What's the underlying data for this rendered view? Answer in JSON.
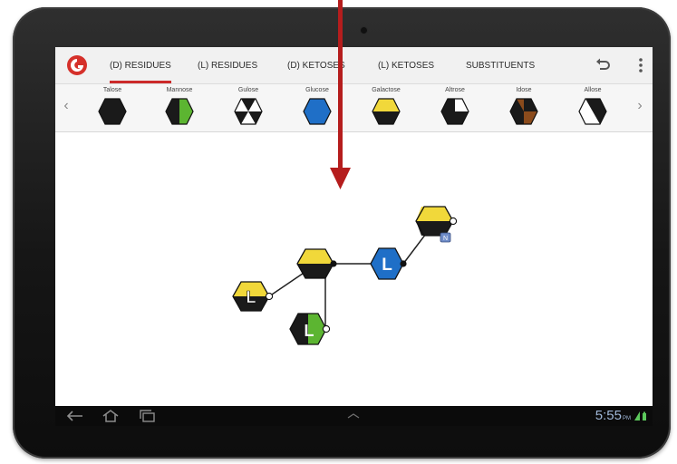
{
  "action_bar": {
    "tabs": [
      {
        "label": "(D) RESIDUES",
        "active": true
      },
      {
        "label": "(L) RESIDUES",
        "active": false
      },
      {
        "label": "(D) KETOSES",
        "active": false
      },
      {
        "label": "(L) KETOSES",
        "active": false
      },
      {
        "label": "SUBSTITUENTS",
        "active": false
      }
    ],
    "icons": [
      "undo-icon",
      "overflow-menu-icon"
    ],
    "accent_color": "#cc2a2a"
  },
  "palette": {
    "items": [
      {
        "label": "Talose",
        "colors": [
          "#1a1a1a"
        ]
      },
      {
        "label": "Mannose",
        "colors": [
          "#1a1a1a",
          "#5cb531"
        ]
      },
      {
        "label": "Gulose",
        "colors": [
          "#ffffff",
          "#1a1a1a"
        ]
      },
      {
        "label": "Glucose",
        "colors": [
          "#1f6fc7"
        ]
      },
      {
        "label": "Galactose",
        "colors": [
          "#f1d83a",
          "#1a1a1a"
        ]
      },
      {
        "label": "Altrose",
        "colors": [
          "#1a1a1a",
          "#ffffff"
        ]
      },
      {
        "label": "Idose",
        "colors": [
          "#1a1a1a",
          "#8b4b1c"
        ]
      },
      {
        "label": "Allose",
        "colors": [
          "#ffffff",
          "#1a1a1a"
        ]
      }
    ]
  },
  "structure": {
    "nodes": [
      {
        "id": "upper-galactose",
        "kind": "galactose",
        "label": "",
        "badge": "N"
      },
      {
        "id": "center-glucose-L",
        "kind": "glucose",
        "label": "L"
      },
      {
        "id": "central-galactose",
        "kind": "galactose",
        "label": ""
      },
      {
        "id": "left-galactose-L",
        "kind": "galactose",
        "label": "L"
      },
      {
        "id": "bottom-mannose-L",
        "kind": "mannose",
        "label": "L"
      }
    ]
  },
  "system_bar": {
    "time": "5:55",
    "time_suffix": "PM"
  }
}
